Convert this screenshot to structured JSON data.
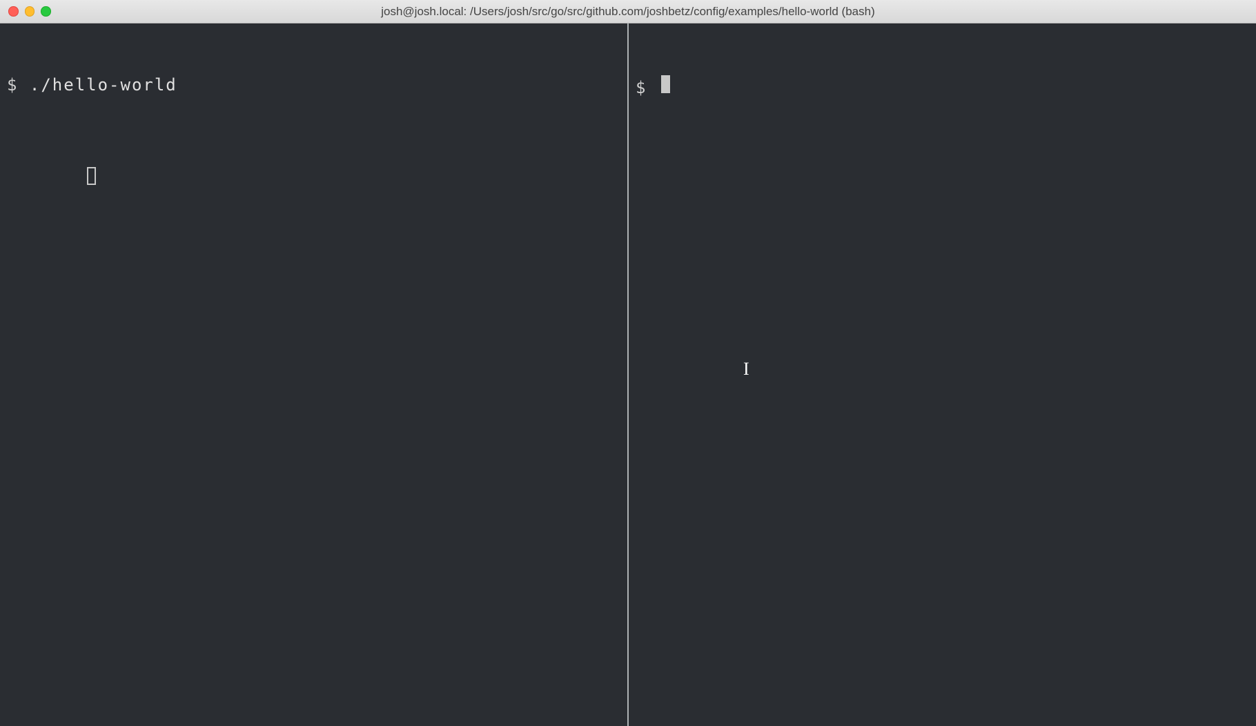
{
  "window": {
    "title": "josh@josh.local: /Users/josh/src/go/src/github.com/joshbetz/config/examples/hello-world (bash)"
  },
  "panes": {
    "left": {
      "prompt": "$ ",
      "command": "./hello-world"
    },
    "right": {
      "prompt": "$ ",
      "command": ""
    }
  },
  "colors": {
    "bg": "#2a2d32",
    "fg": "#dcdcdc",
    "titlebar_text": "#444444",
    "divider": "#aeb2b5",
    "close": "#ff5f57",
    "minimize": "#ffbd2e",
    "zoom": "#28c940"
  }
}
